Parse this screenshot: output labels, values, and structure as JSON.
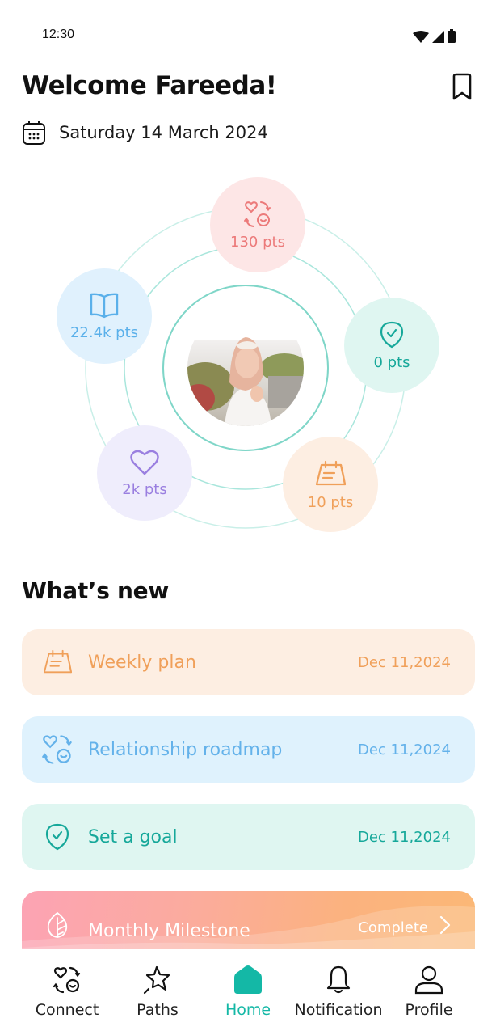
{
  "status_bar": {
    "time": "12:30",
    "icons": [
      "wifi-icon",
      "signal-icon",
      "battery-icon"
    ]
  },
  "header": {
    "title": "Welcome Fareeda!",
    "date": "Saturday 14 March 2024",
    "bookmark_icon": "bookmark-icon",
    "calendar_icon": "calendar-icon"
  },
  "orbit": {
    "avatar_alt": "Profile photo of Fareeda",
    "ring_color": "#7fd6c8",
    "bubbles": [
      {
        "name": "connect",
        "icon": "connect-icon",
        "points": "130 pts",
        "bg": "#fde6e6",
        "color": "#ec7a7a"
      },
      {
        "name": "goal",
        "icon": "goal-shield-icon",
        "points": "0 pts",
        "bg": "#dff6f1",
        "color": "#16a89a"
      },
      {
        "name": "plan",
        "icon": "planner-icon",
        "points": "10 pts",
        "bg": "#fdeee2",
        "color": "#f0a05a"
      },
      {
        "name": "love",
        "icon": "heart-icon",
        "points": "2k pts",
        "bg": "#efedfc",
        "color": "#9a7fe0"
      },
      {
        "name": "learn",
        "icon": "book-icon",
        "points": "22.4k pts",
        "bg": "#e0f1fd",
        "color": "#5ab0ea"
      }
    ]
  },
  "whats_new": {
    "title": "What’s new",
    "items": [
      {
        "label": "Weekly plan",
        "date": "Dec 11,2024",
        "icon": "planner-icon",
        "bg": "#fdeee2",
        "color": "#f0a05a"
      },
      {
        "label": "Relationship roadmap",
        "date": "Dec 11,2024",
        "icon": "connect-icon",
        "bg": "#dff2fd",
        "color": "#64b2ea"
      },
      {
        "label": "Set a goal",
        "date": "Dec 11,2024",
        "icon": "goal-shield-icon",
        "bg": "#dff6f1",
        "color": "#16a89a"
      }
    ],
    "milestone": {
      "label": "Monthly Milestone",
      "status": "Complete",
      "icon": "leaf-icon"
    }
  },
  "tabbar": {
    "active_color": "#14b8a6",
    "tabs": [
      {
        "label": "Connect",
        "icon": "connect-icon",
        "active": false
      },
      {
        "label": "Paths",
        "icon": "star-wand-icon",
        "active": false
      },
      {
        "label": "Home",
        "icon": "home-icon",
        "active": true
      },
      {
        "label": "Notification",
        "icon": "bell-icon",
        "active": false
      },
      {
        "label": "Profile",
        "icon": "user-icon",
        "active": false
      }
    ]
  }
}
